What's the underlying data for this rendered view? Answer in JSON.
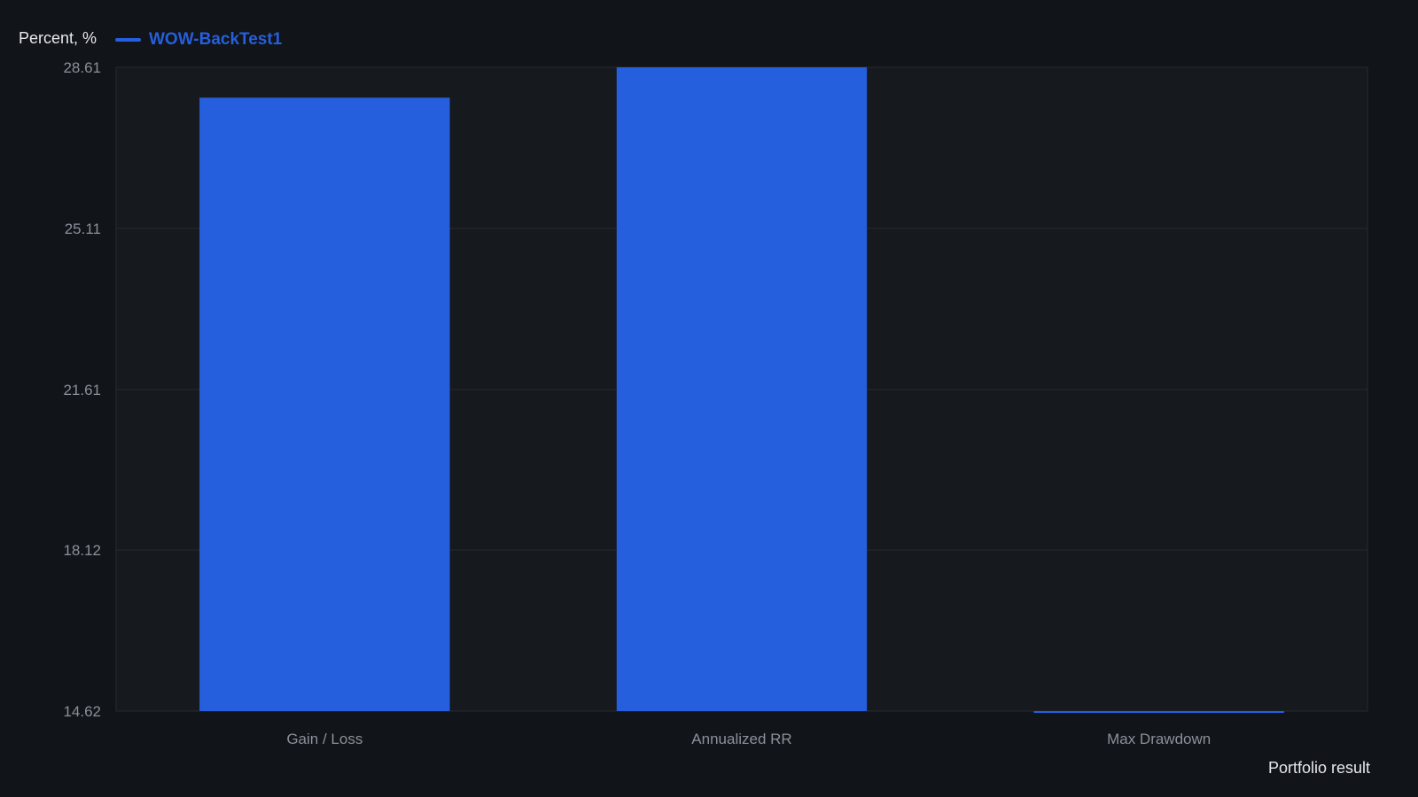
{
  "chart_data": {
    "type": "bar",
    "ylabel": "Percent, %",
    "xlabel": "Portfolio result",
    "categories": [
      "Gain / Loss",
      "Annualized RR",
      "Max Drawdown"
    ],
    "series": [
      {
        "name": "WOW-BackTest1",
        "color": "#255fdd",
        "values": [
          27.95,
          28.61,
          14.58
        ]
      }
    ],
    "yticks": [
      "28.61",
      "25.11",
      "21.61",
      "18.12",
      "14.62"
    ],
    "ylim": [
      14.62,
      28.61
    ],
    "grid": true,
    "legend_position": "top-left"
  },
  "colors": {
    "background": "#111418",
    "plot_background": "#16191e",
    "grid": "#262a31",
    "bar": "#255fdd"
  }
}
